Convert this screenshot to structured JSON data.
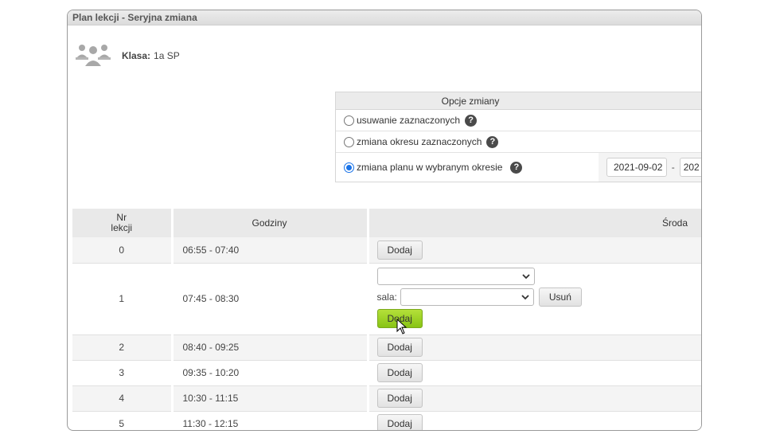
{
  "panel": {
    "title": "Plan lekcji - Seryjna zmiana"
  },
  "class_info": {
    "label": "Klasa:",
    "value": "1a SP",
    "icon": "students-group-icon"
  },
  "options": {
    "header": "Opcje zmiany",
    "items": [
      {
        "label": "usuwanie zaznaczonych",
        "checked": false
      },
      {
        "label": "zmiana okresu zaznaczonych",
        "checked": false
      },
      {
        "label": "zmiana planu w wybranym okresie",
        "checked": true
      }
    ],
    "help_glyph": "?",
    "date_from": "2021-09-02",
    "date_separator": "-",
    "date_to": "202"
  },
  "schedule": {
    "headers": {
      "nr": "Nr\nlekcji",
      "hours": "Godziny",
      "day": "Środa"
    },
    "rows": [
      {
        "nr": "0",
        "hours": "06:55 - 07:40"
      },
      {
        "nr": "1",
        "hours": "07:45 - 08:30"
      },
      {
        "nr": "2",
        "hours": "08:40 - 09:25"
      },
      {
        "nr": "3",
        "hours": "09:35 - 10:20"
      },
      {
        "nr": "4",
        "hours": "10:30 - 11:15"
      },
      {
        "nr": "5",
        "hours": "11:30 - 12:15"
      }
    ],
    "add_label": "Dodaj",
    "room_label": "sala:",
    "remove_label": "Usuń"
  }
}
